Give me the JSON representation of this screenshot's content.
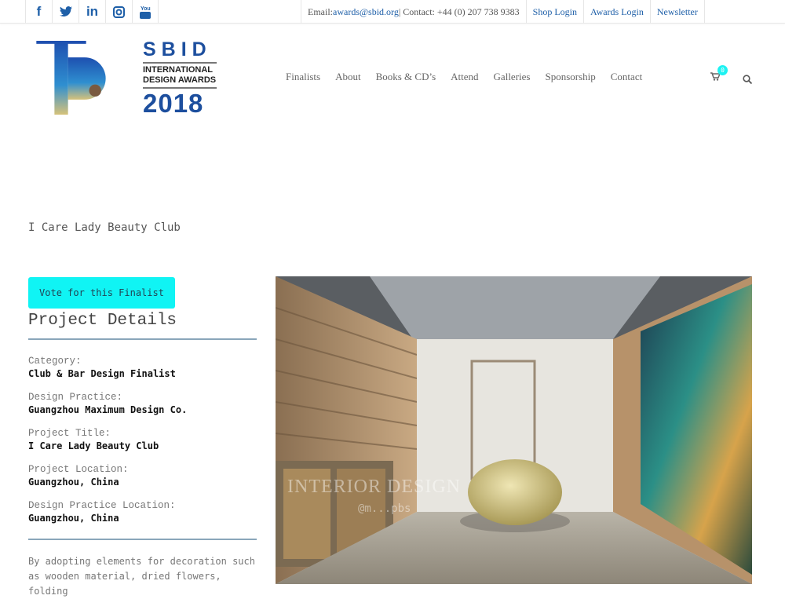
{
  "topbar": {
    "social": [
      {
        "icon": "facebook-icon",
        "glyph": "f"
      },
      {
        "icon": "twitter-icon",
        "glyph": "t"
      },
      {
        "icon": "linkedin-icon",
        "glyph": "in"
      },
      {
        "icon": "instagram-icon",
        "glyph": "◘"
      },
      {
        "icon": "youtube-icon",
        "glyph": "▣"
      }
    ],
    "email_label": "Email: ",
    "email": "awards@sbid.org",
    "contact_label": " | Contact: +44 (0) 207 738 9383",
    "links": [
      "Shop Login",
      "Awards Login",
      "Newsletter"
    ]
  },
  "logo": {
    "line1": "SBID",
    "line2": "INTERNATIONAL",
    "line3": "DESIGN AWARDS",
    "year": "2018"
  },
  "nav": {
    "items": [
      "Finalists",
      "About",
      "Books & CD’s",
      "Attend",
      "Galleries",
      "Sponsorship",
      "Contact"
    ],
    "cart_count": "0"
  },
  "page": {
    "title": "I Care Lady Beauty Club",
    "vote_label": "Vote for this Finalist",
    "details_heading": "Project Details"
  },
  "fields": [
    {
      "label": "Category:",
      "value": "Club & Bar Design Finalist"
    },
    {
      "label": "Design Practice:",
      "value": "Guangzhou Maximum Design Co."
    },
    {
      "label": "Project Title:",
      "value": "I Care Lady Beauty Club"
    },
    {
      "label": "Project Location:",
      "value": "Guangzhou, China"
    },
    {
      "label": "Design Practice Location:",
      "value": "Guangzhou, China"
    }
  ],
  "description": "By adopting elements for decoration such as wooden material, dried flowers, folding",
  "photo": {
    "watermark": "INTERIOR DESIGN",
    "watermark_handle": "@m...pbs"
  },
  "colors": {
    "accent": "#10f4f4",
    "link": "#1e5fa8",
    "rule": "#8aa6ba"
  }
}
